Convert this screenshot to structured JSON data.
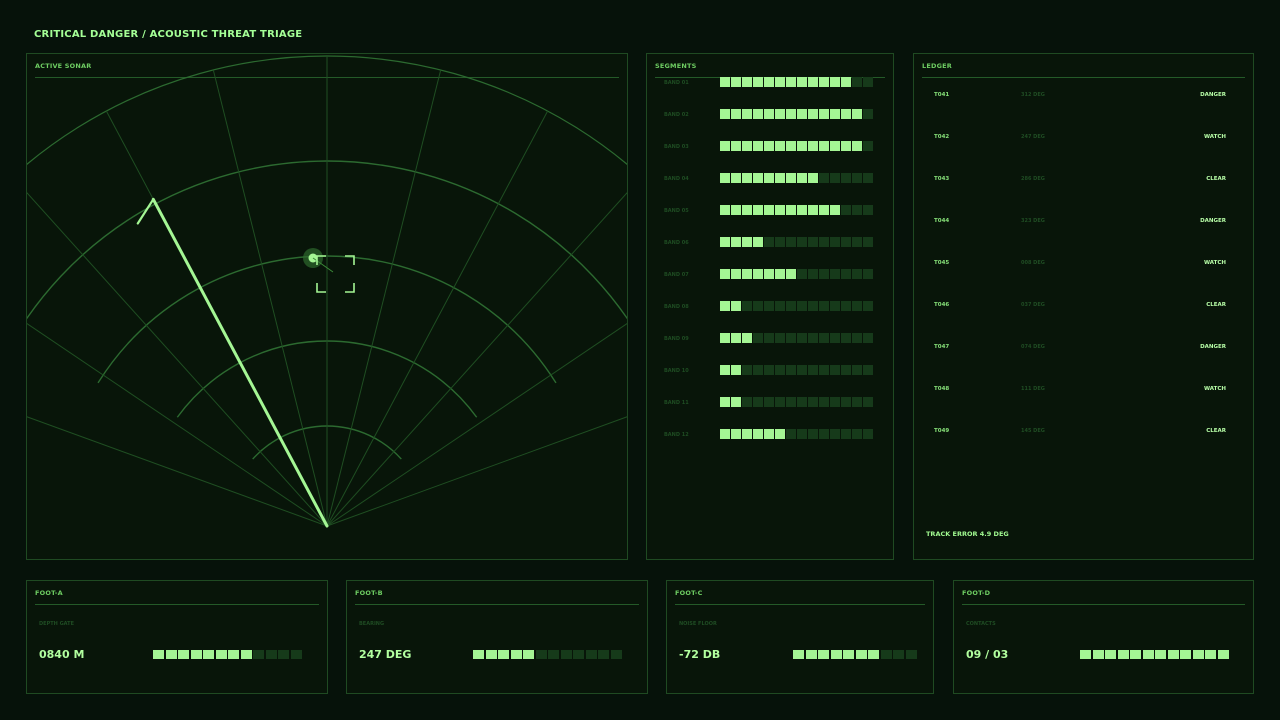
{
  "title": "CRITICAL DANGER / ACOUSTIC THREAT TRIAGE",
  "sonar": {
    "heading": "ACTIVE SONAR"
  },
  "segments": {
    "heading": "SEGMENTS",
    "cells_total": 14,
    "rows": [
      {
        "label": "BAND 01",
        "level": 12
      },
      {
        "label": "BAND 02",
        "level": 13
      },
      {
        "label": "BAND 03",
        "level": 13
      },
      {
        "label": "BAND 04",
        "level": 9
      },
      {
        "label": "BAND 05",
        "level": 11
      },
      {
        "label": "BAND 06",
        "level": 4
      },
      {
        "label": "BAND 07",
        "level": 7
      },
      {
        "label": "BAND 08",
        "level": 2
      },
      {
        "label": "BAND 09",
        "level": 3
      },
      {
        "label": "BAND 10",
        "level": 2
      },
      {
        "label": "BAND 11",
        "level": 2
      },
      {
        "label": "BAND 12",
        "level": 6
      }
    ]
  },
  "ledger": {
    "heading": "LEDGER",
    "rows": [
      {
        "id": "T041",
        "bearing": "312 DEG",
        "status": "DANGER"
      },
      {
        "id": "T042",
        "bearing": "247 DEG",
        "status": "WATCH"
      },
      {
        "id": "T043",
        "bearing": "286 DEG",
        "status": "CLEAR"
      },
      {
        "id": "T044",
        "bearing": "323 DEG",
        "status": "DANGER"
      },
      {
        "id": "T045",
        "bearing": "008 DEG",
        "status": "WATCH"
      },
      {
        "id": "T046",
        "bearing": "037 DEG",
        "status": "CLEAR"
      },
      {
        "id": "T047",
        "bearing": "074 DEG",
        "status": "DANGER"
      },
      {
        "id": "T048",
        "bearing": "111 DEG",
        "status": "WATCH"
      },
      {
        "id": "T049",
        "bearing": "145 DEG",
        "status": "CLEAR"
      }
    ],
    "track_error": "TRACK ERROR 4.9 DEG"
  },
  "footer": [
    {
      "heading": "FOOT-A",
      "label": "DEPTH GATE",
      "value": "0840 M",
      "level": 8,
      "cells_total": 12
    },
    {
      "heading": "FOOT-B",
      "label": "BEARING",
      "value": "247 DEG",
      "level": 5,
      "cells_total": 12
    },
    {
      "heading": "FOOT-C",
      "label": "NOISE FLOOR",
      "value": "-72 DB",
      "level": 7,
      "cells_total": 10
    },
    {
      "heading": "FOOT-D",
      "label": "CONTACTS",
      "value": "09 / 03",
      "level": 12,
      "cells_total": 12
    }
  ],
  "colors": {
    "background": "#06120a",
    "accent": "#a4f694",
    "grid": "#2c6a30",
    "cell_off": "#163a1a"
  }
}
